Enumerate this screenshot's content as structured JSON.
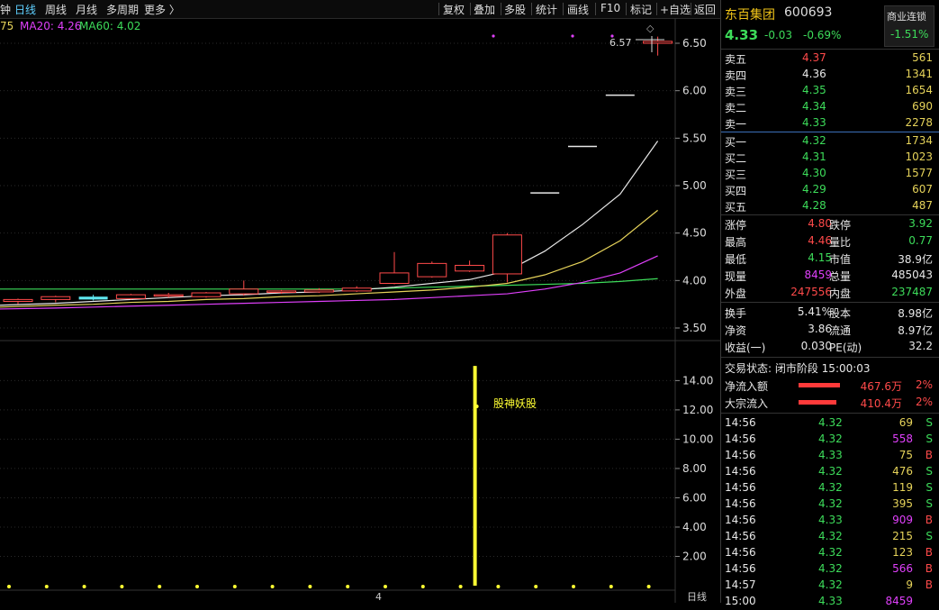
{
  "toolbar": {
    "left_cut": "钟",
    "periods": [
      "日线",
      "周线",
      "月线",
      "多周期",
      "更多 〉"
    ],
    "buttons": [
      "复权",
      "叠加",
      "多股",
      "统计",
      "画线",
      "F10",
      "标记",
      "+自选",
      "返回"
    ]
  },
  "ma_legend": {
    "ma10_cut": "75",
    "ma20": "MA20: 4.26",
    "ma60": "MA60: 4.02"
  },
  "price_axis": [
    "6.50",
    "6.00",
    "5.50",
    "5.00",
    "4.50",
    "4.00",
    "3.50"
  ],
  "volume_axis": [
    "14.00",
    "12.00",
    "10.00",
    "8.00",
    "6.00",
    "4.00",
    "2.00"
  ],
  "price_marker": "6.57",
  "indicator_label": "股神妖股",
  "x_axis_label": "4",
  "period_label": "日线",
  "colors": {
    "up": "#ff4a4a",
    "down": "#3ddc5a",
    "flat_cyan": "#5fe8f0",
    "ma5": "#e8e8e8",
    "ma10": "#e6d35a",
    "ma20": "#e040fb",
    "ma60": "#3ddc5a",
    "vol": "#ffff33"
  },
  "chart_data": {
    "type": "candlestick",
    "ylim": [
      3.4,
      6.7
    ],
    "candles": [
      {
        "o": 3.78,
        "h": 3.81,
        "l": 3.75,
        "c": 3.8
      },
      {
        "o": 3.8,
        "h": 3.84,
        "l": 3.77,
        "c": 3.83
      },
      {
        "o": 3.83,
        "h": 3.85,
        "l": 3.79,
        "c": 3.8
      },
      {
        "o": 3.81,
        "h": 3.86,
        "l": 3.8,
        "c": 3.85
      },
      {
        "o": 3.84,
        "h": 3.87,
        "l": 3.82,
        "c": 3.85
      },
      {
        "o": 3.83,
        "h": 3.88,
        "l": 3.82,
        "c": 3.87
      },
      {
        "o": 3.86,
        "h": 4.0,
        "l": 3.84,
        "c": 3.91
      },
      {
        "o": 3.88,
        "h": 3.9,
        "l": 3.86,
        "c": 3.89
      },
      {
        "o": 3.88,
        "h": 3.92,
        "l": 3.87,
        "c": 3.9
      },
      {
        "o": 3.89,
        "h": 3.94,
        "l": 3.88,
        "c": 3.92
      },
      {
        "o": 3.97,
        "h": 4.3,
        "l": 3.96,
        "c": 4.08
      },
      {
        "o": 4.04,
        "h": 4.2,
        "l": 4.03,
        "c": 4.18
      },
      {
        "o": 4.1,
        "h": 4.21,
        "l": 4.09,
        "c": 4.16
      },
      {
        "o": 4.07,
        "h": 4.5,
        "l": 3.98,
        "c": 4.48
      },
      {
        "o": 4.93,
        "h": 4.93,
        "l": 4.93,
        "c": 4.93
      },
      {
        "o": 5.42,
        "h": 5.42,
        "l": 5.42,
        "c": 5.42
      },
      {
        "o": 5.96,
        "h": 5.96,
        "l": 5.96,
        "c": 5.96
      },
      {
        "o": 6.5,
        "h": 6.57,
        "l": 6.37,
        "c": 6.52
      }
    ],
    "ma5": [
      3.74,
      3.76,
      3.78,
      3.8,
      3.82,
      3.84,
      3.85,
      3.87,
      3.88,
      3.9,
      3.93,
      3.97,
      4.01,
      4.1,
      4.31,
      4.59,
      4.91,
      5.47
    ],
    "ma10": [
      3.72,
      3.74,
      3.75,
      3.77,
      3.78,
      3.8,
      3.81,
      3.83,
      3.84,
      3.86,
      3.88,
      3.9,
      3.93,
      3.97,
      4.06,
      4.2,
      4.42,
      4.74
    ],
    "ma20": [
      3.7,
      3.71,
      3.72,
      3.73,
      3.74,
      3.75,
      3.76,
      3.77,
      3.78,
      3.79,
      3.8,
      3.82,
      3.84,
      3.86,
      3.91,
      3.98,
      4.08,
      4.26
    ],
    "ma60": [
      3.91,
      3.91,
      3.91,
      3.91,
      3.91,
      3.91,
      3.91,
      3.91,
      3.91,
      3.91,
      3.92,
      3.93,
      3.94,
      3.95,
      3.96,
      3.97,
      3.99,
      4.02
    ],
    "vol_ylim": [
      0,
      15.5
    ],
    "vol_spike_index": 12,
    "vol_spike_value": 15.0
  },
  "quote": {
    "name": "东百集团",
    "code": "600693",
    "badge": "商业连锁",
    "price": "4.33",
    "change": "-0.03",
    "pct": "-0.69%",
    "badge_pct": "-1.51%",
    "asks": [
      {
        "label": "卖五",
        "price": "4.37",
        "vol": "561"
      },
      {
        "label": "卖四",
        "price": "4.36",
        "vol": "1341"
      },
      {
        "label": "卖三",
        "price": "4.35",
        "vol": "1654"
      },
      {
        "label": "卖二",
        "price": "4.34",
        "vol": "690"
      },
      {
        "label": "卖一",
        "price": "4.33",
        "vol": "2278"
      }
    ],
    "bids": [
      {
        "label": "买一",
        "price": "4.32",
        "vol": "1734"
      },
      {
        "label": "买二",
        "price": "4.31",
        "vol": "1023"
      },
      {
        "label": "买三",
        "price": "4.30",
        "vol": "1577"
      },
      {
        "label": "买四",
        "price": "4.29",
        "vol": "607"
      },
      {
        "label": "买五",
        "price": "4.28",
        "vol": "487"
      }
    ],
    "stats": [
      {
        "l1": "涨停",
        "v1": "4.80",
        "l2": "跌停",
        "v2": "3.92"
      },
      {
        "l1": "最高",
        "v1": "4.46",
        "l2": "量比",
        "v2": "0.77"
      },
      {
        "l1": "最低",
        "v1": "4.15",
        "l2": "市值",
        "v2": "38.9亿"
      },
      {
        "l1": "现量",
        "v1": "8459",
        "l2": "总量",
        "v2": "485043"
      },
      {
        "l1": "外盘",
        "v1": "247556",
        "l2": "内盘",
        "v2": "237487"
      },
      {
        "l1": "换手",
        "v1": "5.41%",
        "l2": "股本",
        "v2": "8.98亿"
      },
      {
        "l1": "净资",
        "v1": "3.86",
        "l2": "流通",
        "v2": "8.97亿"
      },
      {
        "l1": "收益(一)",
        "v1": "0.030",
        "l2": "PE(动)",
        "v2": "32.2"
      }
    ],
    "trade_status": "交易状态: 闭市阶段 15:00:03",
    "flows": [
      {
        "label": "净流入额",
        "value": "467.6万",
        "pct": "2%"
      },
      {
        "label": "大宗流入",
        "value": "410.4万",
        "pct": "2%"
      }
    ],
    "ticks": [
      {
        "t": "14:56",
        "p": "4.32",
        "v": "69",
        "s": "S"
      },
      {
        "t": "14:56",
        "p": "4.32",
        "v": "558",
        "s": "S"
      },
      {
        "t": "14:56",
        "p": "4.33",
        "v": "75",
        "s": "B"
      },
      {
        "t": "14:56",
        "p": "4.32",
        "v": "476",
        "s": "S"
      },
      {
        "t": "14:56",
        "p": "4.32",
        "v": "119",
        "s": "S"
      },
      {
        "t": "14:56",
        "p": "4.32",
        "v": "395",
        "s": "S"
      },
      {
        "t": "14:56",
        "p": "4.33",
        "v": "909",
        "s": "B"
      },
      {
        "t": "14:56",
        "p": "4.32",
        "v": "215",
        "s": "S"
      },
      {
        "t": "14:56",
        "p": "4.32",
        "v": "123",
        "s": "B"
      },
      {
        "t": "14:56",
        "p": "4.32",
        "v": "566",
        "s": "B"
      },
      {
        "t": "14:57",
        "p": "4.32",
        "v": "9",
        "s": "B"
      },
      {
        "t": "15:00",
        "p": "4.33",
        "v": "8459",
        "s": ""
      }
    ]
  }
}
